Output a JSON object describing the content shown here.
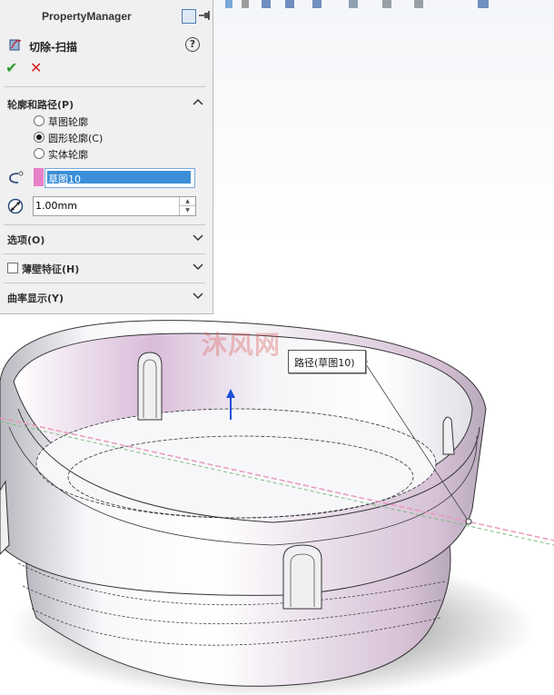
{
  "panel": {
    "title": "PropertyManager",
    "feature_name": "切除-扫描",
    "help_label": "?",
    "ok_label": "✔",
    "cancel_label": "✕"
  },
  "profile_path_section": {
    "title": "轮廓和路径(P)",
    "options": [
      {
        "label": "草图轮廓",
        "selected": false
      },
      {
        "label": "圆形轮廓(C)",
        "selected": true
      },
      {
        "label": "实体轮廓",
        "selected": false
      }
    ],
    "path_value": "草图10",
    "diameter_value": "1.00mm"
  },
  "sections": {
    "options": "选项(O)",
    "thin_feature": "薄壁特征(H)",
    "curvature_display": "曲率显示(Y)"
  },
  "viewport": {
    "callout_text": "路径(草图10)",
    "watermark": "沐风网"
  },
  "colors": {
    "profile_swatch": "#e880c8",
    "selection": "#3b8fd8",
    "ok": "#2e9d2e",
    "cancel": "#d42020"
  },
  "icons": [
    "property-manager-expand-icon",
    "pushpin-icon",
    "sweep-cut-icon",
    "help-icon",
    "path-icon",
    "diameter-icon",
    "chevron-up-icon",
    "chevron-down-icon"
  ]
}
